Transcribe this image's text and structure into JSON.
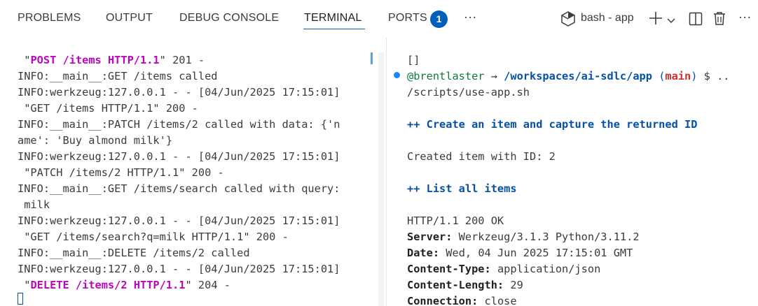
{
  "tabs": {
    "problems": "PROBLEMS",
    "output": "OUTPUT",
    "debug_console": "DEBUG CONSOLE",
    "terminal": "TERMINAL",
    "ports": "PORTS",
    "ports_badge": "1",
    "more": "···"
  },
  "terminal_toolbar": {
    "terminal_name": "bash - app",
    "new_terminal_icon": "plus-icon",
    "dropdown_icon": "chevron-down-icon",
    "split_icon": "split-terminal-icon",
    "kill_icon": "trash-icon",
    "more": "···"
  },
  "left_terminal": {
    "l1_a": " ",
    "l1_q1": "\"",
    "l1_req": "POST /items HTTP/1.1",
    "l1_q2": "\"",
    "l1_rest": " 201 -",
    "l2": "INFO:__main__:GET /items called",
    "l3": "INFO:werkzeug:127.0.0.1 - - [04/Jun/2025 17:15:01]",
    "l4": " \"GET /items HTTP/1.1\" 200 -",
    "l5": "INFO:__main__:PATCH /items/2 called with data: {'n",
    "l6": "ame': 'Buy almond milk'}",
    "l7": "INFO:werkzeug:127.0.0.1 - - [04/Jun/2025 17:15:01]",
    "l8": " \"PATCH /items/2 HTTP/1.1\" 200 -",
    "l9": "INFO:__main__:GET /items/search called with query:",
    "l10": " milk",
    "l11": "INFO:werkzeug:127.0.0.1 - - [04/Jun/2025 17:15:01]",
    "l12": " \"GET /items/search?q=milk HTTP/1.1\" 200 -",
    "l13": "INFO:__main__:DELETE /items/2 called",
    "l14": "INFO:werkzeug:127.0.0.1 - - [04/Jun/2025 17:15:01]",
    "l15_a": " ",
    "l15_q1": "\"",
    "l15_req": "DELETE /items/2 HTTP/1.1",
    "l15_q2": "\"",
    "l15_rest": " 204 -"
  },
  "right_terminal": {
    "r1": "[]",
    "r2_user": "@brentlaster",
    "r2_arrow": " → ",
    "r2_path": "/workspaces/ai-sdlc/app",
    "r2_paren_open": " (",
    "r2_branch": "main",
    "r2_paren_close": ")",
    "r2_prompt": " $ ..",
    "r3": "/scripts/use-app.sh",
    "r4": "++ Create an item and capture the returned ID",
    "r5": "Created item with ID: 2",
    "r6": "++ List all items",
    "r7": "HTTP/1.1 200 OK",
    "r8_k": "Server:",
    "r8_v": " Werkzeug/3.1.3 Python/3.11.2",
    "r9_k": "Date:",
    "r9_v": " Wed, 04 Jun 2025 17:15:01 GMT",
    "r10_k": "Content-Type:",
    "r10_v": " application/json",
    "r11_k": "Content-Length:",
    "r11_v": " 29",
    "r12_k": "Connection:",
    "r12_v": " close"
  }
}
